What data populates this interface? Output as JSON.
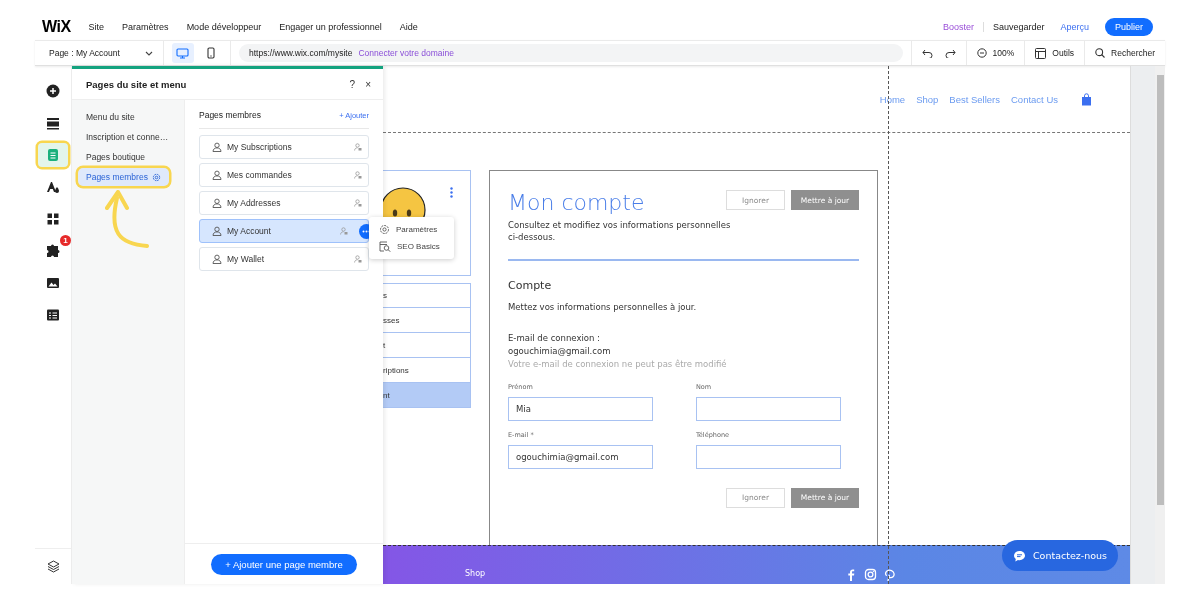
{
  "top_menu": {
    "logo": "WiX",
    "items": [
      "Site",
      "Paramètres",
      "Mode développeur",
      "Engager un professionnel",
      "Aide"
    ],
    "booster": "Booster",
    "save": "Sauvegarder",
    "preview": "Aperçu",
    "publish": "Publier"
  },
  "toolbar": {
    "page_selector": "Page : My Account",
    "devices": [
      {
        "kind": "desktop",
        "selected": true
      },
      {
        "kind": "mobile",
        "selected": false
      }
    ],
    "url": "https://www.wix.com/mysite",
    "connect_domain": "Connecter votre domaine",
    "zoom": "100%",
    "tools": "Outils",
    "search": "Rechercher"
  },
  "left_rail": [
    {
      "kind": "add",
      "selected": false,
      "highlighted": false
    },
    {
      "kind": "sections",
      "selected": false,
      "highlighted": false
    },
    {
      "kind": "pages",
      "selected": true,
      "highlighted": true
    },
    {
      "kind": "design",
      "selected": false,
      "highlighted": false
    },
    {
      "kind": "apps",
      "selected": false,
      "highlighted": false
    },
    {
      "kind": "business",
      "selected": false,
      "highlighted": false,
      "badge": "1"
    },
    {
      "kind": "media",
      "selected": false,
      "highlighted": false
    },
    {
      "kind": "cms",
      "selected": false,
      "highlighted": false
    }
  ],
  "panel": {
    "title": "Pages du site et menu",
    "help": "?",
    "close": "×",
    "categories": [
      {
        "label": "Menu du site",
        "selected": false,
        "highlighted": false
      },
      {
        "label": "Inscription et conne…",
        "selected": false,
        "highlighted": false
      },
      {
        "label": "Pages boutique",
        "selected": false,
        "highlighted": false
      },
      {
        "label": "Pages membres",
        "selected": true,
        "highlighted": true
      }
    ],
    "section_title": "Pages membres",
    "add_link": "+ Ajouter",
    "pages": [
      {
        "label": "My Subscriptions",
        "selected": false
      },
      {
        "label": "Mes commandes",
        "selected": false
      },
      {
        "label": "My Addresses",
        "selected": false
      },
      {
        "label": "My Account",
        "selected": true
      },
      {
        "label": "My Wallet",
        "selected": false
      }
    ],
    "context_menu": [
      {
        "kind": "settings",
        "label": "Paramètres"
      },
      {
        "kind": "seo",
        "label": "SEO Basics"
      }
    ],
    "add_button": "+ Ajouter une page membre"
  },
  "site": {
    "nav": [
      "Home",
      "Shop",
      "Best Sellers",
      "Contact Us"
    ],
    "member_menu": [
      {
        "label": "s",
        "selected": false
      },
      {
        "label": "sses",
        "selected": false
      },
      {
        "label": "t",
        "selected": false
      },
      {
        "label": "riptions",
        "selected": false
      },
      {
        "label": "nt",
        "selected": true
      }
    ],
    "account": {
      "title": "Mon compte",
      "intro": "Consultez et modifiez vos informations personnelles ci-dessous.",
      "ignore": "Ignorer",
      "update": "Mettre à jour",
      "section": "Compte",
      "subtitle": "Mettez vos informations personnelles à jour.",
      "login_label": "E-mail de connexion :",
      "login_email": "ogouchimia@gmail.com",
      "login_note": "Votre e-mail de connexion ne peut pas être modifié",
      "fields": [
        {
          "label": "Prénom",
          "value": "Mia"
        },
        {
          "label": "Nom"
        },
        {
          "label": "E-mail *",
          "value": "ogouchimia@gmail.com"
        },
        {
          "label": "Téléphone"
        }
      ],
      "bottom_ignore": "Ignorer",
      "bottom_update": "Mettre à jour"
    },
    "footer": {
      "link": "Shop"
    },
    "chat_button": "Contactez-nous"
  }
}
